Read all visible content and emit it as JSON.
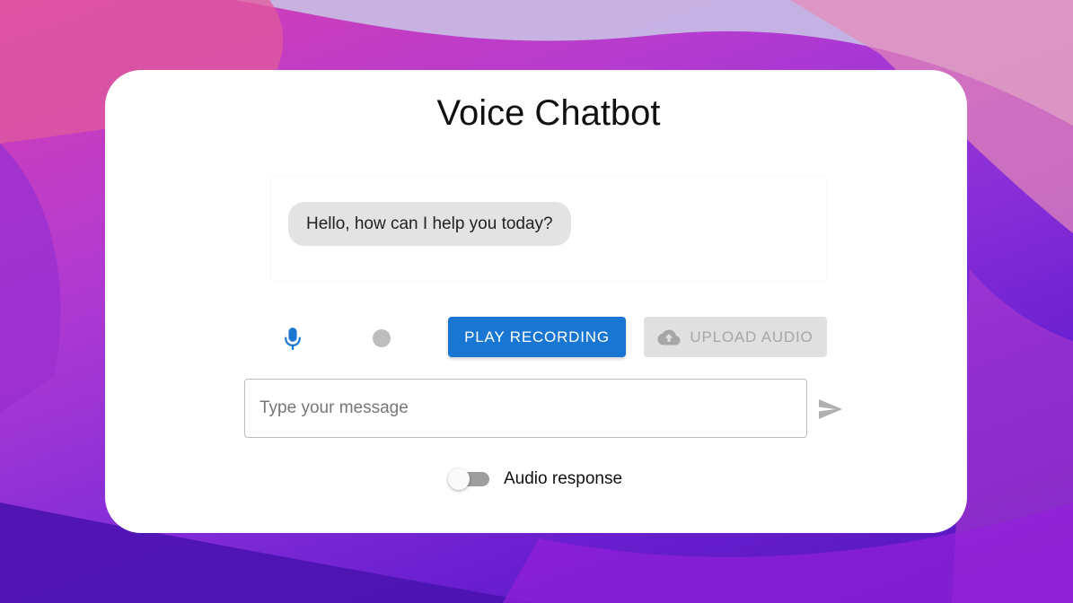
{
  "app": {
    "title": "Voice Chatbot"
  },
  "chat": {
    "messages": [
      {
        "role": "bot",
        "text": "Hello, how can I help you today?"
      }
    ]
  },
  "controls": {
    "mic_icon": "mic-icon",
    "record_indicator": "record-dot-icon",
    "play_label": "PLAY RECORDING",
    "upload_label": "UPLOAD AUDIO",
    "upload_icon": "cloud-upload-icon",
    "play_color": "#1976d2",
    "upload_disabled": true
  },
  "composer": {
    "placeholder": "Type your message",
    "value": "",
    "send_icon": "send-icon"
  },
  "audio_response": {
    "label": "Audio response",
    "enabled": false
  }
}
